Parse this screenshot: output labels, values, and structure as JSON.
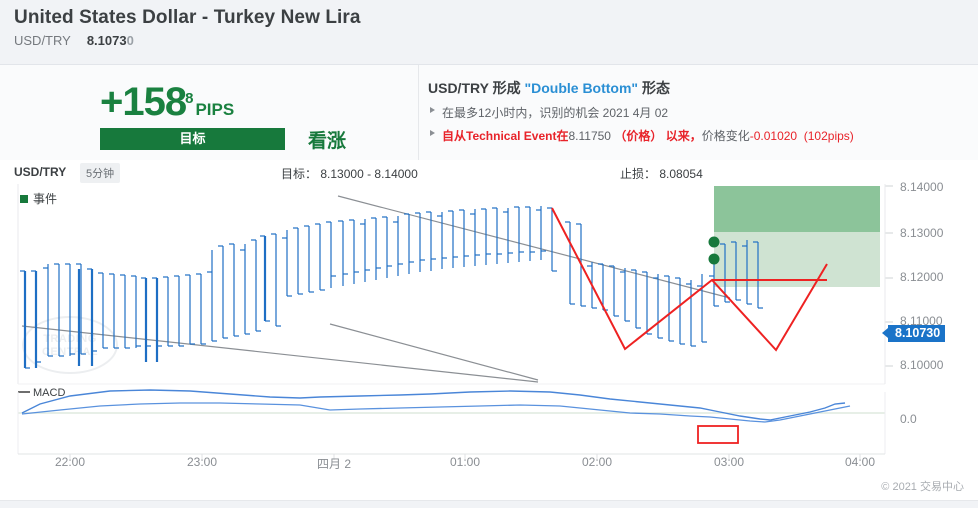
{
  "header": {
    "title": "United States Dollar - Turkey New Lira",
    "pair": "USD/TRY",
    "price_main": "8.1073",
    "price_tail": "0"
  },
  "summary": {
    "pips_sign_value": "+158",
    "pips_sup": "8",
    "pips_unit": "PIPS",
    "target_chip": "目标",
    "direction": "看涨"
  },
  "event": {
    "head_prefix": "USD/TRY 形成 ",
    "head_pattern": "\"Double Bottom\"",
    "head_suffix": " 形态",
    "row1": "在最多12小时内，识别的机会 2021 4月 02",
    "row2_a": "自从Technical Event在",
    "row2_b": "8.11750",
    "row2_c": "（价格）",
    "row2_d": "以来，",
    "row2_e": "价格变化",
    "row2_f": "-0.01020",
    "row2_g": "(102pips)"
  },
  "chart_info": {
    "pair": "USD/TRY",
    "timeframe": "5分钟",
    "target_label": "目标：",
    "target_value": "8.13000 - 8.14000",
    "stop_label": "止损：",
    "stop_value": "8.08054",
    "legend_event": "事件"
  },
  "axis": {
    "y_labels": [
      "8.14000",
      "8.13000",
      "8.12000",
      "8.11000",
      "8.10000"
    ],
    "y_macd_label": "0.0",
    "current_price_badge": "8.10730",
    "x_labels": [
      "22:00",
      "23:00",
      "四月 2",
      "01:00",
      "02:00",
      "03:00",
      "04:00"
    ]
  },
  "watermark": {
    "line1": "TRADING",
    "line2": "CENTRAL"
  },
  "copyright": "© 2021 交易中心",
  "colors": {
    "bullish_green": "#17793c",
    "bar_blue": "#1f6fc4",
    "pattern_red": "#ee2222",
    "target_zone_dark": "#8cc49a",
    "target_zone_light": "#cfe3d2",
    "price_badge_blue": "#1a73c8",
    "macd_line": "#4a86d8"
  },
  "chart_data": {
    "type": "ohlc",
    "title": "USD/TRY 5分钟",
    "ylabel": "",
    "xlabel": "",
    "ylim": [
      8.095,
      8.145
    ],
    "xlim": [
      "21:40",
      "04:20"
    ],
    "grid": false,
    "current_price": 8.1073,
    "target_zone": [
      8.13,
      8.14
    ],
    "entry_zone": [
      8.12,
      8.13
    ],
    "stop_loss": 8.08054,
    "pattern": {
      "name": "Double Bottom",
      "points": [
        {
          "x": "01:35",
          "y": 8.1245
        },
        {
          "x": "02:20",
          "y": 8.1035
        },
        {
          "x": "02:35",
          "y": 8.1195
        },
        {
          "x": "02:55",
          "y": 8.103
        },
        {
          "x": "03:10",
          "y": 8.121
        }
      ],
      "neckline": 8.1195
    },
    "trendlines": [
      {
        "name": "upper",
        "from": {
          "x": "23:20",
          "y": 8.1295
        },
        "to": {
          "x": "03:10",
          "y": 8.116
        }
      },
      {
        "name": "lower",
        "from": {
          "x": "21:45",
          "y": 8.1085
        },
        "to": {
          "x": "01:05",
          "y": 8.097
        }
      }
    ],
    "target_dots": [
      8.126,
      8.123
    ],
    "indicator": {
      "name": "MACD",
      "zero_line": 0.0,
      "signal_box": {
        "x": "02:50",
        "note": "bullish crossover"
      }
    },
    "ohlc": [
      {
        "t": "21:45",
        "o": 8.1135,
        "h": 8.1165,
        "l": 8.1015,
        "c": 8.1022
      },
      {
        "t": "21:50",
        "o": 8.1022,
        "h": 8.116,
        "l": 8.1018,
        "c": 8.1035
      },
      {
        "t": "21:55",
        "o": 8.1035,
        "h": 8.117,
        "l": 8.102,
        "c": 8.103
      },
      {
        "t": "22:00",
        "o": 8.103,
        "h": 8.1182,
        "l": 8.106,
        "c": 8.1075
      },
      {
        "t": "22:05",
        "o": 8.1075,
        "h": 8.118,
        "l": 8.1062,
        "c": 8.107
      },
      {
        "t": "22:10",
        "o": 8.107,
        "h": 8.1178,
        "l": 8.1055,
        "c": 8.1065
      },
      {
        "t": "22:15",
        "o": 8.1065,
        "h": 8.118,
        "l": 8.1052,
        "c": 8.1062
      },
      {
        "t": "22:20",
        "o": 8.1062,
        "h": 8.116,
        "l": 8.105,
        "c": 8.1058
      },
      {
        "t": "22:25",
        "o": 8.1058,
        "h": 8.1155,
        "l": 8.1043,
        "c": 8.105
      },
      {
        "t": "22:30",
        "o": 8.105,
        "h": 8.115,
        "l": 8.104,
        "c": 8.1048
      },
      {
        "t": "22:35",
        "o": 8.1048,
        "h": 8.1152,
        "l": 8.1038,
        "c": 8.1045
      },
      {
        "t": "22:40",
        "o": 8.1045,
        "h": 8.1148,
        "l": 8.1037,
        "c": 8.1042
      },
      {
        "t": "22:45",
        "o": 8.1042,
        "h": 8.115,
        "l": 8.1035,
        "c": 8.104
      },
      {
        "t": "22:50",
        "o": 8.104,
        "h": 8.1148,
        "l": 8.1036,
        "c": 8.1042
      },
      {
        "t": "22:55",
        "o": 8.1042,
        "h": 8.115,
        "l": 8.1038,
        "c": 8.1045
      },
      {
        "t": "23:00",
        "o": 8.1045,
        "h": 8.1152,
        "l": 8.104,
        "c": 8.1048
      },
      {
        "t": "23:05",
        "o": 8.1048,
        "h": 8.1155,
        "l": 8.1042,
        "c": 8.105
      },
      {
        "t": "23:10",
        "o": 8.105,
        "h": 8.1158,
        "l": 8.1045,
        "c": 8.1052
      },
      {
        "t": "23:15",
        "o": 8.1052,
        "h": 8.1215,
        "l": 8.1082,
        "c": 8.111
      },
      {
        "t": "23:20",
        "o": 8.111,
        "h": 8.122,
        "l": 8.1085,
        "c": 8.1115
      },
      {
        "t": "23:25",
        "o": 8.1115,
        "h": 8.1218,
        "l": 8.1088,
        "c": 8.1112
      },
      {
        "t": "23:30",
        "o": 8.1112,
        "h": 8.1222,
        "l": 8.109,
        "c": 8.1118
      },
      {
        "t": "23:35",
        "o": 8.1118,
        "h": 8.1228,
        "l": 8.1092,
        "c": 8.112
      },
      {
        "t": "23:40",
        "o": 8.112,
        "h": 8.1232,
        "l": 8.106,
        "c": 8.1075
      },
      {
        "t": "23:45",
        "o": 8.1075,
        "h": 8.1235,
        "l": 8.1078,
        "c": 8.1122
      },
      {
        "t": "23:50",
        "o": 8.1122,
        "h": 8.1238,
        "l": 8.11,
        "c": 8.1128
      },
      {
        "t": "23:55",
        "o": 8.1128,
        "h": 8.124,
        "l": 8.1105,
        "c": 8.113
      },
      {
        "t": "00:00",
        "o": 8.113,
        "h": 8.1242,
        "l": 8.111,
        "c": 8.1132
      },
      {
        "t": "00:05",
        "o": 8.1132,
        "h": 8.1245,
        "l": 8.1112,
        "c": 8.1135
      },
      {
        "t": "00:10",
        "o": 8.1135,
        "h": 8.1248,
        "l": 8.1118,
        "c": 8.1138
      },
      {
        "t": "00:15",
        "o": 8.1138,
        "h": 8.125,
        "l": 8.112,
        "c": 8.1142
      },
      {
        "t": "00:20",
        "o": 8.1142,
        "h": 8.1252,
        "l": 8.1125,
        "c": 8.1145
      },
      {
        "t": "00:25",
        "o": 8.1145,
        "h": 8.125,
        "l": 8.1128,
        "c": 8.1148
      },
      {
        "t": "00:30",
        "o": 8.1148,
        "h": 8.1248,
        "l": 8.113,
        "c": 8.115
      },
      {
        "t": "00:35",
        "o": 8.115,
        "h": 8.125,
        "l": 8.1132,
        "c": 8.1152
      },
      {
        "t": "00:40",
        "o": 8.1152,
        "h": 8.1252,
        "l": 8.1135,
        "c": 8.1155
      },
      {
        "t": "00:45",
        "o": 8.1155,
        "h": 8.125,
        "l": 8.1138,
        "c": 8.1158
      },
      {
        "t": "00:50",
        "o": 8.1158,
        "h": 8.1252,
        "l": 8.114,
        "c": 8.116
      },
      {
        "t": "00:55",
        "o": 8.116,
        "h": 8.125,
        "l": 8.1142,
        "c": 8.1158
      },
      {
        "t": "01:00",
        "o": 8.1158,
        "h": 8.1252,
        "l": 8.1145,
        "c": 8.116
      },
      {
        "t": "01:05",
        "o": 8.116,
        "h": 8.125,
        "l": 8.1148,
        "c": 8.1162
      },
      {
        "t": "01:10",
        "o": 8.1162,
        "h": 8.1252,
        "l": 8.115,
        "c": 8.1158
      },
      {
        "t": "01:15",
        "o": 8.1158,
        "h": 8.125,
        "l": 8.1148,
        "c": 8.1155
      },
      {
        "t": "01:20",
        "o": 8.1155,
        "h": 8.1248,
        "l": 8.1145,
        "c": 8.1152
      },
      {
        "t": "01:25",
        "o": 8.1152,
        "h": 8.125,
        "l": 8.1142,
        "c": 8.115
      },
      {
        "t": "01:30",
        "o": 8.115,
        "h": 8.1248,
        "l": 8.114,
        "c": 8.1148
      },
      {
        "t": "01:35",
        "o": 8.1148,
        "h": 8.1245,
        "l": 8.1135,
        "c": 8.1142
      },
      {
        "t": "01:40",
        "o": 8.1142,
        "h": 8.117,
        "l": 8.1048,
        "c": 8.1055
      },
      {
        "t": "01:45",
        "o": 8.1055,
        "h": 8.1168,
        "l": 8.1045,
        "c": 8.1052
      },
      {
        "t": "01:50",
        "o": 8.1052,
        "h": 8.1165,
        "l": 8.1042,
        "c": 8.1048
      },
      {
        "t": "01:55",
        "o": 8.1048,
        "h": 8.1162,
        "l": 8.104,
        "c": 8.1045
      },
      {
        "t": "02:00",
        "o": 8.1045,
        "h": 8.116,
        "l": 8.1032,
        "c": 8.1038
      },
      {
        "t": "02:05",
        "o": 8.1038,
        "h": 8.1158,
        "l": 8.1028,
        "c": 8.1035
      },
      {
        "t": "02:10",
        "o": 8.1035,
        "h": 8.1155,
        "l": 8.1025,
        "c": 8.1032
      },
      {
        "t": "02:15",
        "o": 8.1032,
        "h": 8.1152,
        "l": 8.1022,
        "c": 8.1028
      },
      {
        "t": "02:20",
        "o": 8.1028,
        "h": 8.115,
        "l": 8.1018,
        "c": 8.1035
      },
      {
        "t": "02:25",
        "o": 8.1035,
        "h": 8.1195,
        "l": 8.104,
        "c": 8.1085
      },
      {
        "t": "02:30",
        "o": 8.1085,
        "h": 8.1192,
        "l": 8.1038,
        "c": 8.1075
      },
      {
        "t": "02:35",
        "o": 8.1075,
        "h": 8.119,
        "l": 8.103,
        "c": 8.1048
      },
      {
        "t": "02:40",
        "o": 8.1048,
        "h": 8.1185,
        "l": 8.1025,
        "c": 8.104
      },
      {
        "t": "02:45",
        "o": 8.104,
        "h": 8.118,
        "l": 8.102,
        "c": 8.1032
      },
      {
        "t": "02:50",
        "o": 8.1032,
        "h": 8.1178,
        "l": 8.1016,
        "c": 8.103
      },
      {
        "t": "02:55",
        "o": 8.103,
        "h": 8.1182,
        "l": 8.1018,
        "c": 8.1055
      },
      {
        "t": "03:00",
        "o": 8.1055,
        "h": 8.1208,
        "l": 8.1052,
        "c": 8.109
      },
      {
        "t": "03:05",
        "o": 8.109,
        "h": 8.1212,
        "l": 8.106,
        "c": 8.1095
      },
      {
        "t": "03:10",
        "o": 8.1095,
        "h": 8.1215,
        "l": 8.1062,
        "c": 8.1098
      },
      {
        "t": "03:15",
        "o": 8.1098,
        "h": 8.1212,
        "l": 8.1058,
        "c": 8.1092
      },
      {
        "t": "03:20",
        "o": 8.1092,
        "h": 8.121,
        "l": 8.1055,
        "c": 8.1088
      },
      {
        "t": "03:25",
        "o": 8.1088,
        "h": 8.1212,
        "l": 8.106,
        "c": 8.1073
      }
    ]
  }
}
